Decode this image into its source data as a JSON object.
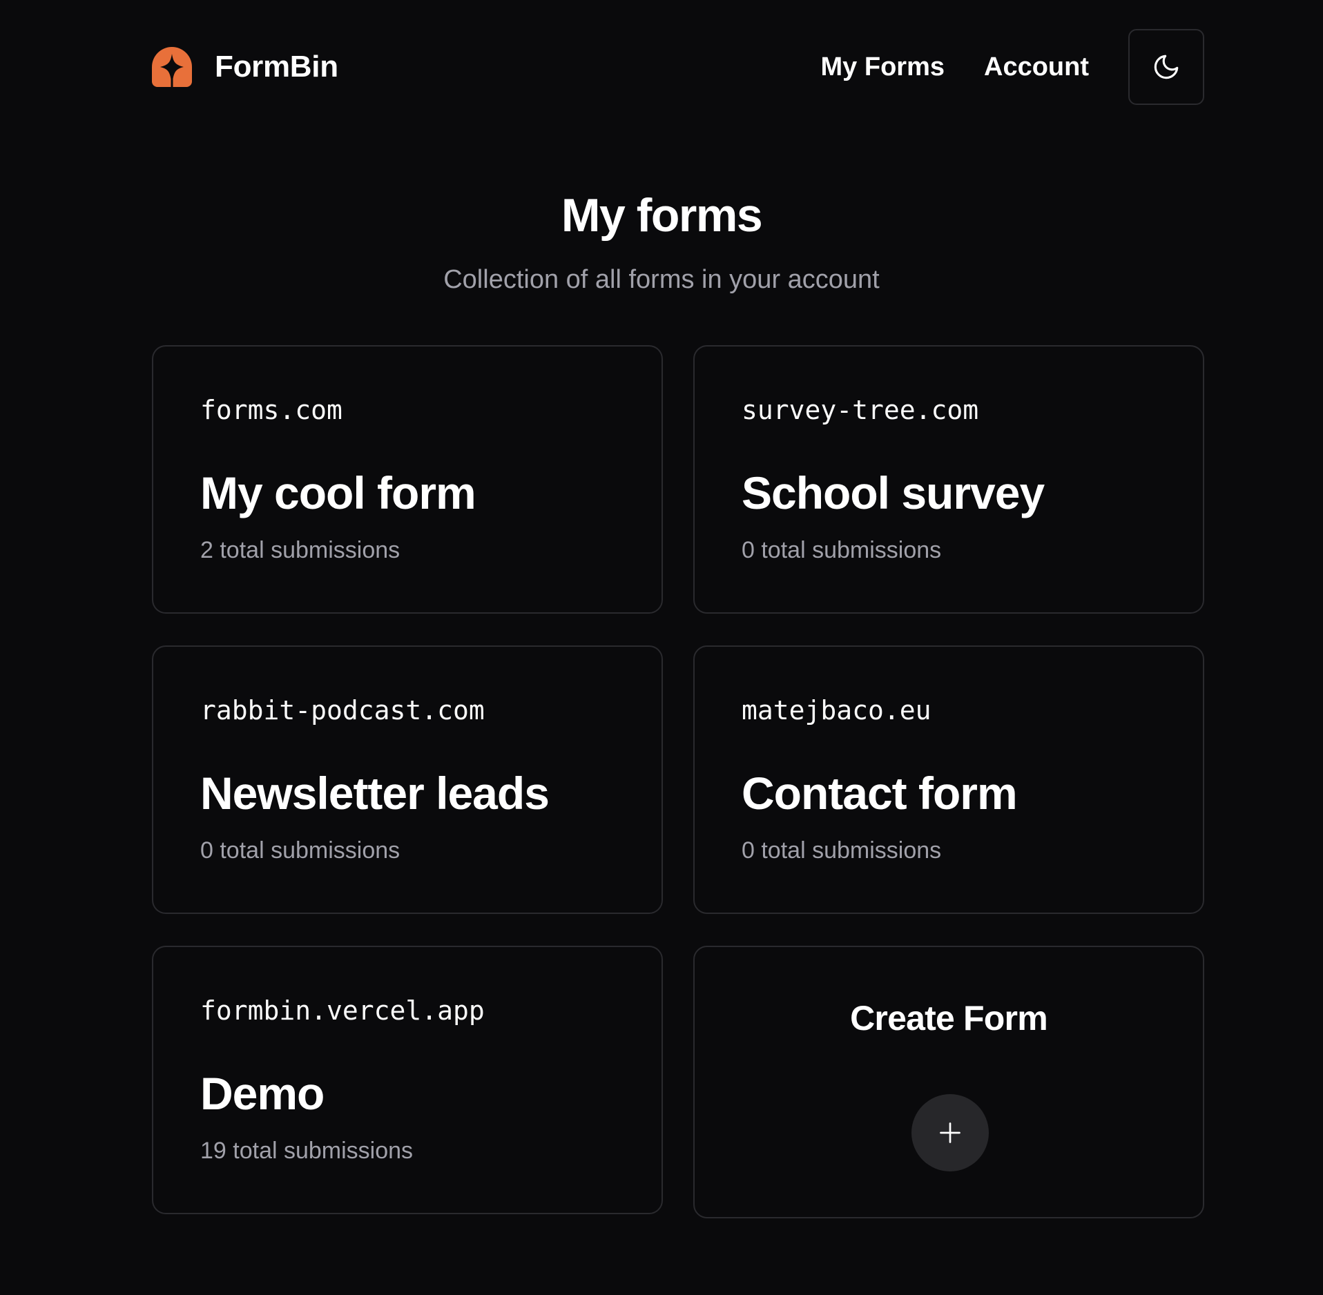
{
  "header": {
    "brand_name": "FormBin",
    "brand_icon": "formbin-logo-icon",
    "nav": [
      {
        "label": "My Forms"
      },
      {
        "label": "Account"
      }
    ],
    "theme_toggle_icon": "moon-icon"
  },
  "page": {
    "title": "My forms",
    "subtitle": "Collection of all forms in your account"
  },
  "forms": [
    {
      "domain": "forms.com",
      "name": "My cool form",
      "submissions": "2 total submissions"
    },
    {
      "domain": "survey-tree.com",
      "name": "School survey",
      "submissions": "0 total submissions"
    },
    {
      "domain": "rabbit-podcast.com",
      "name": "Newsletter leads",
      "submissions": "0 total submissions"
    },
    {
      "domain": "matejbaco.eu",
      "name": "Contact form",
      "submissions": "0 total submissions"
    },
    {
      "domain": "formbin.vercel.app",
      "name": "Demo",
      "submissions": "19 total submissions"
    }
  ],
  "create": {
    "title": "Create Form",
    "button_icon": "plus-icon"
  },
  "colors": {
    "background": "#0a0a0c",
    "accent": "#e8703a",
    "muted_text": "#a1a1aa",
    "border": "#2a2a2e",
    "button_bg": "#27272a"
  }
}
